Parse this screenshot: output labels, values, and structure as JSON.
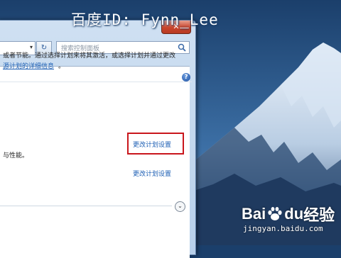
{
  "watermark_top": "百度ID: Fynn_Lee",
  "window": {
    "close_label": "✕",
    "address": {
      "dropdown": "▾",
      "refresh": "↻"
    },
    "search": {
      "placeholder": "搜索控制面板"
    },
    "help": "?",
    "description": {
      "line1": "或者节能。通过选择计划来将其激活，或选择计划并通过更改",
      "line2_link": "源计划的详细信息",
      "line2_tail": "。"
    },
    "plans": [
      {
        "link": "更改计划设置",
        "highlighted": true
      },
      {
        "desc": "与性能。",
        "link": "更改计划设置",
        "highlighted": false
      }
    ],
    "expand": "⌄"
  },
  "logo": {
    "main_left": "Bai",
    "main_mid": "du",
    "main_right": "经验",
    "sub": "jingyan.baidu.com"
  },
  "colors": {
    "link": "#1d5fb4",
    "highlight": "#c9161c",
    "sky_top": "#1b3f6b",
    "sky_bottom": "#3c6fa5"
  }
}
